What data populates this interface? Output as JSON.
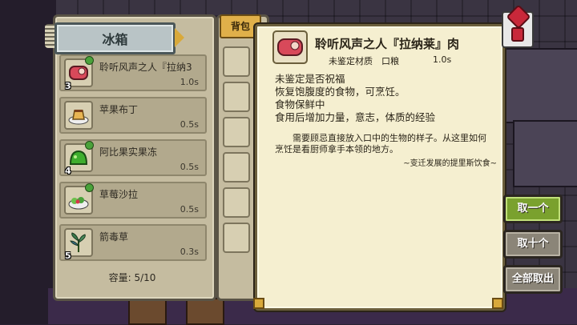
{
  "fridge": {
    "title": "冰箱",
    "capacity": "容量: 5/10",
    "items": [
      {
        "name": "聆听风声之人『拉纳3",
        "time": "1.0s",
        "count": "3",
        "icon": "meat-icon"
      },
      {
        "name": "苹果布丁",
        "time": "0.5s",
        "count": "",
        "icon": "pudding-icon"
      },
      {
        "name": "阿比果实果冻",
        "time": "0.5s",
        "count": "4",
        "icon": "jelly-icon"
      },
      {
        "name": "草莓沙拉",
        "time": "0.5s",
        "count": "",
        "icon": "salad-icon"
      },
      {
        "name": "箭毒草",
        "time": "0.3s",
        "count": "5",
        "icon": "herb-icon"
      }
    ]
  },
  "bag": {
    "tab_label": "背包"
  },
  "detail": {
    "name": "聆听风声之人『拉纳莱』肉",
    "category": "未鉴定材质",
    "type": "口粮",
    "time": "1.0s",
    "effects": [
      "未鉴定是否祝福",
      "恢复饱腹度的食物，可烹饪。",
      "食物保鲜中",
      "食用后增加力量，意志，体质的经验"
    ],
    "description": "需要顾忌直接放入口中的生物的样子。从这里如何烹饪是看厨师拿手本领的地方。",
    "source": "~变迁发展的提里斯饮食~"
  },
  "buttons": {
    "take_one": "取一个",
    "take_ten": "取十个",
    "take_all": "全部取出"
  },
  "colors": {
    "active_button": "#7aa12e",
    "panel": "#c5bca0",
    "popup": "#f5efd0"
  }
}
